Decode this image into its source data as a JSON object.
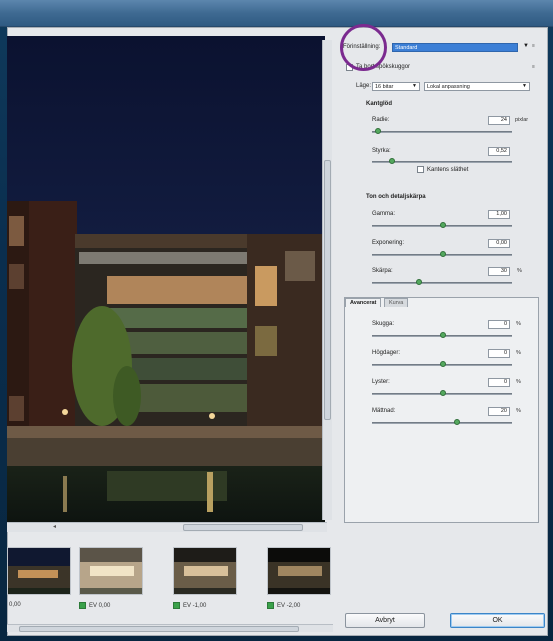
{
  "panel": {
    "preset_label": "Förinställning:",
    "preset_value": "Standard",
    "remove_ghosts_label": "Ta bort spökskuggor",
    "mode_label": "Läge:",
    "mode_bits": "16 bitar",
    "mode_method": "Lokal anpassning",
    "edge_glow": {
      "heading": "Kantglöd",
      "radius_label": "Radie:",
      "radius_value": "24",
      "radius_unit": "pixlar",
      "strength_label": "Styrka:",
      "strength_value": "0,52",
      "smooth_edges_label": "Kantens släthet"
    },
    "tone_detail": {
      "heading": "Ton och detaljskärpa",
      "gamma_label": "Gamma:",
      "gamma_value": "1,00",
      "exposure_label": "Exponering:",
      "exposure_value": "0,00",
      "detail_label": "Skärpa:",
      "detail_value": "30",
      "detail_unit": "%"
    },
    "tabs": {
      "advanced": "Avancerat",
      "curve": "Kurva"
    },
    "advanced": {
      "shadow_label": "Skugga:",
      "shadow_value": "0",
      "highlight_label": "Högdager:",
      "highlight_value": "0",
      "vibrance_label": "Lyster:",
      "vibrance_value": "0",
      "saturation_label": "Mättnad:",
      "saturation_value": "20",
      "unit": "%"
    },
    "cancel": "Avbryt",
    "ok": "OK"
  },
  "thumbnails": [
    {
      "label": "0,00"
    },
    {
      "label": "EV 0,00"
    },
    {
      "label": "EV -1,00"
    },
    {
      "label": "EV -2,00"
    }
  ],
  "chart_data": null,
  "colors": {
    "accent": "#3c7fd6",
    "slider": "#54a85e",
    "annotation": "#7b2a8f"
  }
}
